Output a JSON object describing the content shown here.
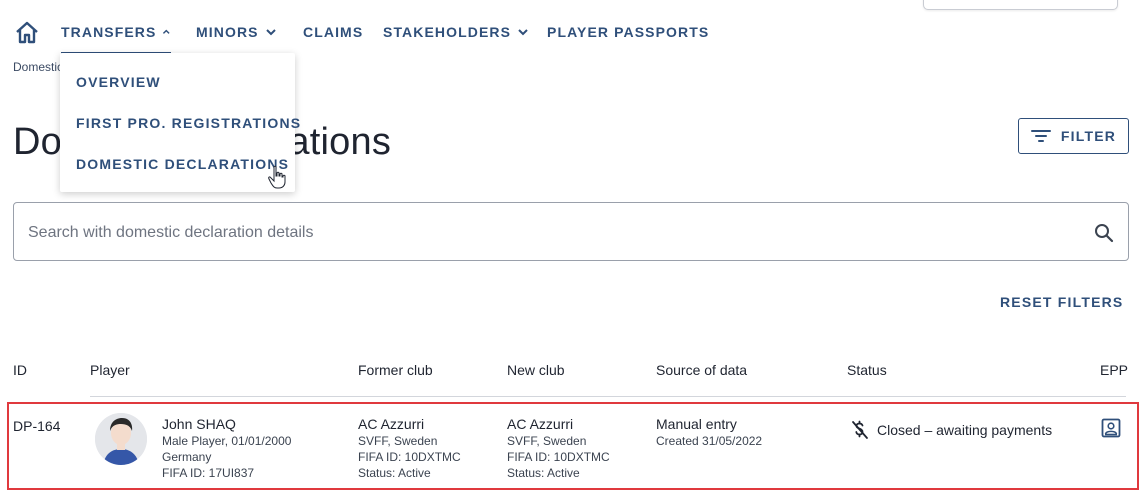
{
  "nav": {
    "items": [
      {
        "label": "TRANSFERS"
      },
      {
        "label": "MINORS"
      },
      {
        "label": "CLAIMS"
      },
      {
        "label": "STAKEHOLDERS"
      },
      {
        "label": "PLAYER PASSPORTS"
      }
    ]
  },
  "breadcrumb": "Domestic",
  "dropdown": {
    "items": [
      {
        "label": "OVERVIEW"
      },
      {
        "label": "FIRST PRO. REGISTRATIONS"
      },
      {
        "label": "DOMESTIC DECLARATIONS"
      }
    ]
  },
  "page": {
    "title": "Domestic declarations",
    "filter_label": "FILTER",
    "reset_label": "RESET FILTERS"
  },
  "search": {
    "placeholder": "Search with domestic declaration details"
  },
  "table": {
    "headers": [
      "ID",
      "Player",
      "Former club",
      "New club",
      "Source of data",
      "Status",
      "EPP"
    ],
    "rows": [
      {
        "id": "DP-164",
        "player": {
          "name": "John SHAQ",
          "detail": "Male Player, 01/01/2000",
          "country": "Germany",
          "fifa_id": "FIFA ID: 17UI837"
        },
        "former_club": {
          "name": "AC Azzurri",
          "federation": "SVFF, Sweden",
          "fifa_id": "FIFA ID: 10DXTMC",
          "status": "Status: Active"
        },
        "new_club": {
          "name": "AC Azzurri",
          "federation": "SVFF, Sweden",
          "fifa_id": "FIFA ID: 10DXTMC",
          "status": "Status: Active"
        },
        "source": {
          "name": "Manual entry",
          "created": "Created 31/05/2022"
        },
        "status": "Closed – awaiting payments"
      }
    ]
  },
  "colors": {
    "primary": "#2f4f7a",
    "highlight_border": "#e0393e",
    "text": "#1f2430"
  }
}
